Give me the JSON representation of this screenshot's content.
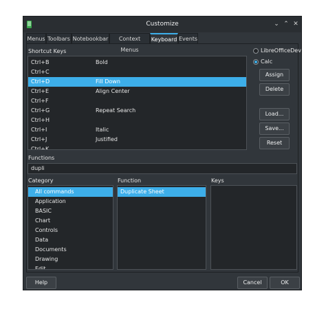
{
  "window": {
    "title": "Customize"
  },
  "titlebar_buttons": {
    "minimize": "⌄",
    "maximize": "⌃",
    "close": "✕"
  },
  "tabs": [
    {
      "label": "Menus"
    },
    {
      "label": "Toolbars"
    },
    {
      "label": "Notebookbar"
    },
    {
      "label": "Context Menus"
    },
    {
      "label": "Keyboard"
    },
    {
      "label": "Events"
    }
  ],
  "shortcut_keys": {
    "label": "Shortcut Keys",
    "rows": [
      {
        "key": "Ctrl+B",
        "command": "Bold"
      },
      {
        "key": "Ctrl+C",
        "command": ""
      },
      {
        "key": "Ctrl+D",
        "command": "Fill Down"
      },
      {
        "key": "Ctrl+E",
        "command": "Align Center"
      },
      {
        "key": "Ctrl+F",
        "command": ""
      },
      {
        "key": "Ctrl+G",
        "command": "Repeat Search"
      },
      {
        "key": "Ctrl+H",
        "command": ""
      },
      {
        "key": "Ctrl+I",
        "command": "Italic"
      },
      {
        "key": "Ctrl+J",
        "command": "Justified"
      },
      {
        "key": "Ctrl+K",
        "command": ""
      }
    ],
    "selected_index": 2
  },
  "scope": {
    "option1": "LibreOfficeDev",
    "option2": "Calc",
    "selected": "Calc"
  },
  "buttons": {
    "assign": "Assign",
    "delete": "Delete",
    "load": "Load...",
    "save": "Save...",
    "reset": "Reset"
  },
  "functions": {
    "label": "Functions",
    "value": "dupli"
  },
  "category": {
    "label": "Category",
    "items": [
      "All commands",
      "Application",
      "BASIC",
      "Chart",
      "Controls",
      "Data",
      "Documents",
      "Drawing",
      "Edit"
    ],
    "selected_index": 0
  },
  "function": {
    "label": "Function",
    "items": [
      "Duplicate Sheet"
    ],
    "selected_index": 0
  },
  "keys": {
    "label": "Keys"
  },
  "footer": {
    "help": "Help",
    "cancel": "Cancel",
    "ok": "OK"
  }
}
